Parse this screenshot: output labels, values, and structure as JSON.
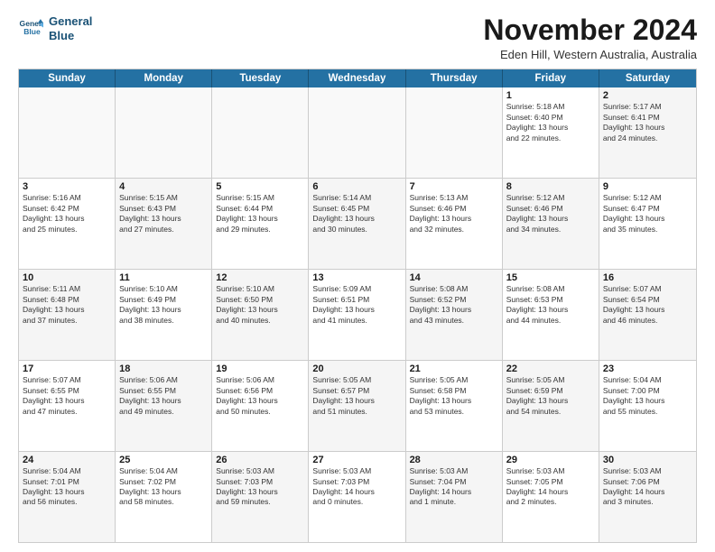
{
  "logo": {
    "line1": "General",
    "line2": "Blue"
  },
  "title": "November 2024",
  "subtitle": "Eden Hill, Western Australia, Australia",
  "days_of_week": [
    "Sunday",
    "Monday",
    "Tuesday",
    "Wednesday",
    "Thursday",
    "Friday",
    "Saturday"
  ],
  "weeks": [
    [
      {
        "day": "",
        "text": "",
        "shaded": false,
        "empty": true
      },
      {
        "day": "",
        "text": "",
        "shaded": false,
        "empty": true
      },
      {
        "day": "",
        "text": "",
        "shaded": false,
        "empty": true
      },
      {
        "day": "",
        "text": "",
        "shaded": false,
        "empty": true
      },
      {
        "day": "",
        "text": "",
        "shaded": false,
        "empty": true
      },
      {
        "day": "1",
        "text": "Sunrise: 5:18 AM\nSunset: 6:40 PM\nDaylight: 13 hours\nand 22 minutes.",
        "shaded": false,
        "empty": false
      },
      {
        "day": "2",
        "text": "Sunrise: 5:17 AM\nSunset: 6:41 PM\nDaylight: 13 hours\nand 24 minutes.",
        "shaded": true,
        "empty": false
      }
    ],
    [
      {
        "day": "3",
        "text": "Sunrise: 5:16 AM\nSunset: 6:42 PM\nDaylight: 13 hours\nand 25 minutes.",
        "shaded": false,
        "empty": false
      },
      {
        "day": "4",
        "text": "Sunrise: 5:15 AM\nSunset: 6:43 PM\nDaylight: 13 hours\nand 27 minutes.",
        "shaded": true,
        "empty": false
      },
      {
        "day": "5",
        "text": "Sunrise: 5:15 AM\nSunset: 6:44 PM\nDaylight: 13 hours\nand 29 minutes.",
        "shaded": false,
        "empty": false
      },
      {
        "day": "6",
        "text": "Sunrise: 5:14 AM\nSunset: 6:45 PM\nDaylight: 13 hours\nand 30 minutes.",
        "shaded": true,
        "empty": false
      },
      {
        "day": "7",
        "text": "Sunrise: 5:13 AM\nSunset: 6:46 PM\nDaylight: 13 hours\nand 32 minutes.",
        "shaded": false,
        "empty": false
      },
      {
        "day": "8",
        "text": "Sunrise: 5:12 AM\nSunset: 6:46 PM\nDaylight: 13 hours\nand 34 minutes.",
        "shaded": true,
        "empty": false
      },
      {
        "day": "9",
        "text": "Sunrise: 5:12 AM\nSunset: 6:47 PM\nDaylight: 13 hours\nand 35 minutes.",
        "shaded": false,
        "empty": false
      }
    ],
    [
      {
        "day": "10",
        "text": "Sunrise: 5:11 AM\nSunset: 6:48 PM\nDaylight: 13 hours\nand 37 minutes.",
        "shaded": true,
        "empty": false
      },
      {
        "day": "11",
        "text": "Sunrise: 5:10 AM\nSunset: 6:49 PM\nDaylight: 13 hours\nand 38 minutes.",
        "shaded": false,
        "empty": false
      },
      {
        "day": "12",
        "text": "Sunrise: 5:10 AM\nSunset: 6:50 PM\nDaylight: 13 hours\nand 40 minutes.",
        "shaded": true,
        "empty": false
      },
      {
        "day": "13",
        "text": "Sunrise: 5:09 AM\nSunset: 6:51 PM\nDaylight: 13 hours\nand 41 minutes.",
        "shaded": false,
        "empty": false
      },
      {
        "day": "14",
        "text": "Sunrise: 5:08 AM\nSunset: 6:52 PM\nDaylight: 13 hours\nand 43 minutes.",
        "shaded": true,
        "empty": false
      },
      {
        "day": "15",
        "text": "Sunrise: 5:08 AM\nSunset: 6:53 PM\nDaylight: 13 hours\nand 44 minutes.",
        "shaded": false,
        "empty": false
      },
      {
        "day": "16",
        "text": "Sunrise: 5:07 AM\nSunset: 6:54 PM\nDaylight: 13 hours\nand 46 minutes.",
        "shaded": true,
        "empty": false
      }
    ],
    [
      {
        "day": "17",
        "text": "Sunrise: 5:07 AM\nSunset: 6:55 PM\nDaylight: 13 hours\nand 47 minutes.",
        "shaded": false,
        "empty": false
      },
      {
        "day": "18",
        "text": "Sunrise: 5:06 AM\nSunset: 6:55 PM\nDaylight: 13 hours\nand 49 minutes.",
        "shaded": true,
        "empty": false
      },
      {
        "day": "19",
        "text": "Sunrise: 5:06 AM\nSunset: 6:56 PM\nDaylight: 13 hours\nand 50 minutes.",
        "shaded": false,
        "empty": false
      },
      {
        "day": "20",
        "text": "Sunrise: 5:05 AM\nSunset: 6:57 PM\nDaylight: 13 hours\nand 51 minutes.",
        "shaded": true,
        "empty": false
      },
      {
        "day": "21",
        "text": "Sunrise: 5:05 AM\nSunset: 6:58 PM\nDaylight: 13 hours\nand 53 minutes.",
        "shaded": false,
        "empty": false
      },
      {
        "day": "22",
        "text": "Sunrise: 5:05 AM\nSunset: 6:59 PM\nDaylight: 13 hours\nand 54 minutes.",
        "shaded": true,
        "empty": false
      },
      {
        "day": "23",
        "text": "Sunrise: 5:04 AM\nSunset: 7:00 PM\nDaylight: 13 hours\nand 55 minutes.",
        "shaded": false,
        "empty": false
      }
    ],
    [
      {
        "day": "24",
        "text": "Sunrise: 5:04 AM\nSunset: 7:01 PM\nDaylight: 13 hours\nand 56 minutes.",
        "shaded": true,
        "empty": false
      },
      {
        "day": "25",
        "text": "Sunrise: 5:04 AM\nSunset: 7:02 PM\nDaylight: 13 hours\nand 58 minutes.",
        "shaded": false,
        "empty": false
      },
      {
        "day": "26",
        "text": "Sunrise: 5:03 AM\nSunset: 7:03 PM\nDaylight: 13 hours\nand 59 minutes.",
        "shaded": true,
        "empty": false
      },
      {
        "day": "27",
        "text": "Sunrise: 5:03 AM\nSunset: 7:03 PM\nDaylight: 14 hours\nand 0 minutes.",
        "shaded": false,
        "empty": false
      },
      {
        "day": "28",
        "text": "Sunrise: 5:03 AM\nSunset: 7:04 PM\nDaylight: 14 hours\nand 1 minute.",
        "shaded": true,
        "empty": false
      },
      {
        "day": "29",
        "text": "Sunrise: 5:03 AM\nSunset: 7:05 PM\nDaylight: 14 hours\nand 2 minutes.",
        "shaded": false,
        "empty": false
      },
      {
        "day": "30",
        "text": "Sunrise: 5:03 AM\nSunset: 7:06 PM\nDaylight: 14 hours\nand 3 minutes.",
        "shaded": true,
        "empty": false
      }
    ]
  ]
}
